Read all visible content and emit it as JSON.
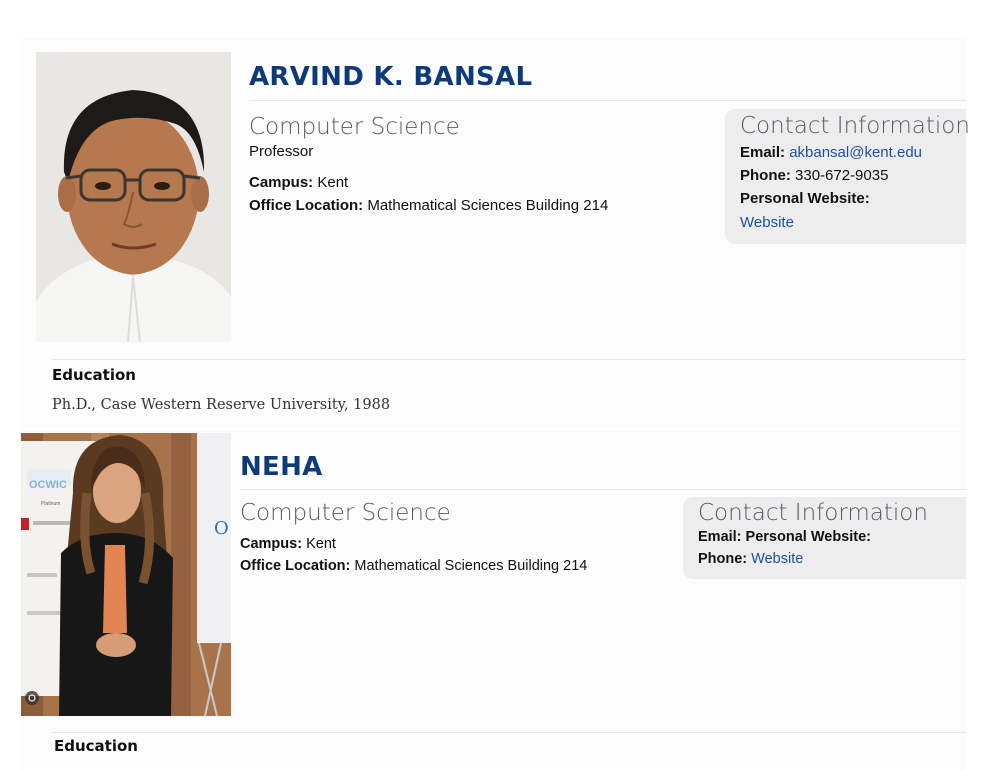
{
  "profiles": [
    {
      "name": "ARVIND K. BANSAL",
      "department": "Computer Science",
      "title": "Professor",
      "campus_label": "Campus:",
      "campus": "Kent",
      "office_label": "Office Location:",
      "office": "Mathematical Sciences Building 214",
      "contact": {
        "heading": "Contact Information",
        "email_label": "Email:",
        "email": "akbansal@kent.edu",
        "phone_label": "Phone:",
        "phone": "330-672-9035",
        "website_label": "Personal Website:",
        "website_link": "Website"
      },
      "education_heading": "Education",
      "education": "Ph.D., Case Western Reserve University, 1988"
    },
    {
      "name": "NEHA",
      "department": "Computer Science",
      "campus_label": "Campus:",
      "campus": "Kent",
      "office_label": "Office Location:",
      "office": "Mathematical Sciences Building 214",
      "contact": {
        "heading": "Contact Information",
        "email_label": "Email:",
        "website_label": "Personal Website:",
        "phone_label": "Phone:",
        "website_link": "Website"
      },
      "education_heading": "Education",
      "photo_sign_text": "OCWIC",
      "photo_badge_text": "Platinum"
    }
  ]
}
